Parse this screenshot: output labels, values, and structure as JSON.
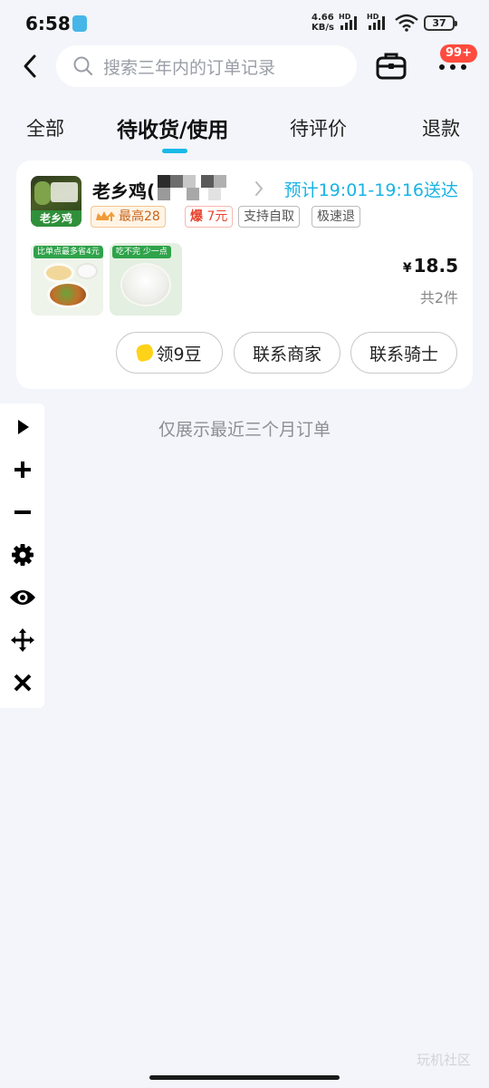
{
  "status_bar": {
    "time": "6:58",
    "net_speed_value": "4.66",
    "net_speed_unit": "KB/s",
    "hd_label_1": "HD",
    "hd_label_2": "HD",
    "battery": "37"
  },
  "header": {
    "search_placeholder": "搜索三年内的订单记录",
    "more_badge": "99+"
  },
  "tabs": [
    {
      "label": "全部",
      "active": false
    },
    {
      "label": "待收货/使用",
      "active": true
    },
    {
      "label": "待评价",
      "active": false
    },
    {
      "label": "退款",
      "active": false
    }
  ],
  "order": {
    "shop_name": "老乡鸡(",
    "shop_logo_text": "老乡鸡",
    "eta": "预计19:01-19:16送达",
    "tags": {
      "best": "最高28",
      "boom_prefix": "爆",
      "boom_value": "7元",
      "self_pickup": "支持自取",
      "fast_refund": "极速退"
    },
    "item_thumbs": [
      {
        "banner": "比单点最多省4元"
      },
      {
        "banner": "吃不完 少一点"
      }
    ],
    "price_symbol": "¥",
    "price": "18.5",
    "item_count": "共2件",
    "actions": {
      "beans": "领9豆",
      "contact_merchant": "联系商家",
      "contact_rider": "联系骑士"
    }
  },
  "notice": "仅展示最近三个月订单",
  "tool_panel": [
    "play-icon",
    "plus-icon",
    "minus-icon",
    "gear-icon",
    "eye-icon",
    "move-icon",
    "close-icon"
  ],
  "watermark": "玩机社区",
  "colors": {
    "accent": "#19b9e8",
    "eta": "#18b3e4",
    "badge": "#ff4b3e",
    "background": "#f3f5fa"
  }
}
